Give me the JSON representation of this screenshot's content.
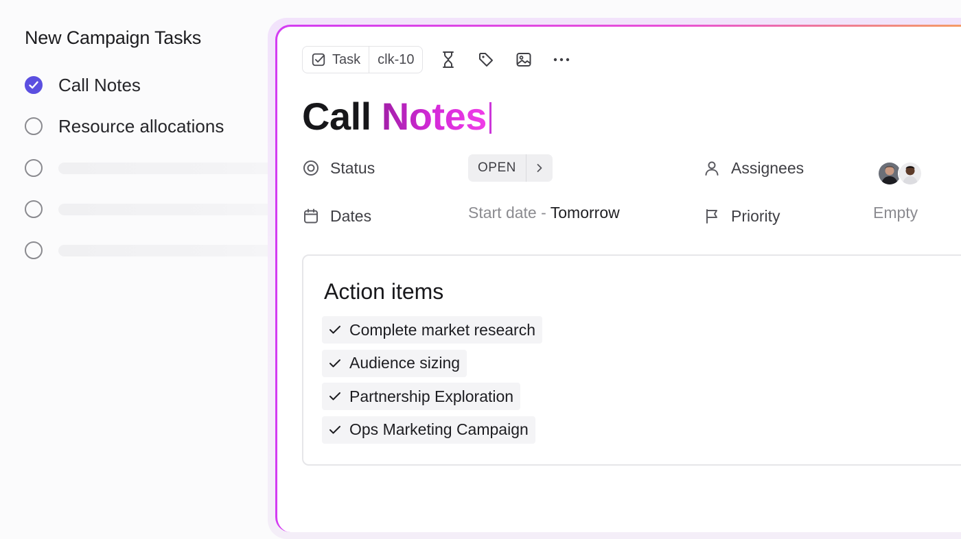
{
  "task_list": {
    "title": "New Campaign Tasks",
    "items": [
      {
        "label": "Call Notes",
        "completed": true
      },
      {
        "label": "Resource allocations",
        "completed": false
      }
    ]
  },
  "task": {
    "type_label": "Task",
    "id": "clk-10",
    "title_part1": "Call ",
    "title_part2": "Notes",
    "fields": {
      "status_label": "Status",
      "status_value": "OPEN",
      "dates_label": "Dates",
      "dates_prefix": "Start date - ",
      "dates_value": "Tomorrow",
      "assignees_label": "Assignees",
      "priority_label": "Priority",
      "priority_value": "Empty"
    },
    "description": {
      "heading": "Action items",
      "items": [
        "Complete market research",
        "Audience sizing",
        "Partnership Exploration",
        "Ops Marketing Campaign"
      ]
    }
  },
  "colors": {
    "accent": "#5b4fe0",
    "title_gradient_start": "#a21fa8",
    "title_gradient_end": "#f03ee8",
    "card_border_start": "#d33cf2",
    "card_border_end": "#f5a35a"
  },
  "icons": [
    "check-square-icon",
    "hourglass-icon",
    "tag-icon",
    "image-icon",
    "more-horizontal-icon",
    "status-circle-icon",
    "calendar-icon",
    "user-icon",
    "flag-icon",
    "chevron-right-icon",
    "checkmark-icon"
  ]
}
